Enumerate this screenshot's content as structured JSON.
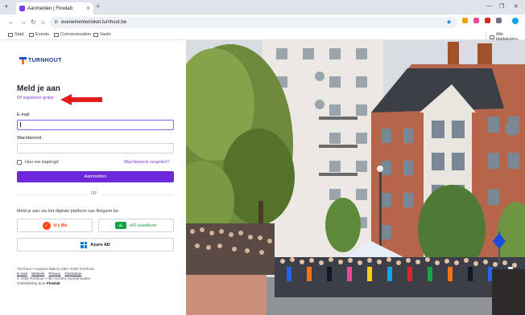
{
  "browser": {
    "tab_title": "Aanmelden | Flowlab",
    "url": "evenementenloket.turnhout.be",
    "bookmarks": [
      "Stad",
      "Events",
      "Communication",
      "Vaste"
    ],
    "all_bookmarks": "Alle bladwijzers"
  },
  "brand": {
    "logo_text": "TURNHOUT"
  },
  "login": {
    "title": "Meld je aan",
    "register_prefix": "Of",
    "register_link": "registreer gratis",
    "email_label": "E-mail",
    "email_value": "",
    "password_label": "Wachtwoord",
    "password_value": "",
    "remember_label": "Hou me ingelogd",
    "forgot_link": "Wachtwoord vergeten?",
    "submit_label": "Aanmelden",
    "or_text": "OF",
    "platform_text": "Meld je aan via het digitale platform van Belgium.be.",
    "itsme_label": "it's Me",
    "eid_label": "eID kaartlezer",
    "azure_label": "Azure AD"
  },
  "footer": {
    "address": "Turnhout • Campus Blairon 200 • 2300 Turnhout",
    "links": [
      "E-mail",
      "Website",
      "Privacy",
      "Disclaimer"
    ],
    "copyright": "© 2025 Turnhout • Alle rechten voorbehouden",
    "dev_prefix": "Ontwikkeling door",
    "dev_name": "Flowlab"
  },
  "colors": {
    "accent": "#6d28d9",
    "link": "#7c3aed",
    "annotation_arrow": "#e11d1d"
  }
}
